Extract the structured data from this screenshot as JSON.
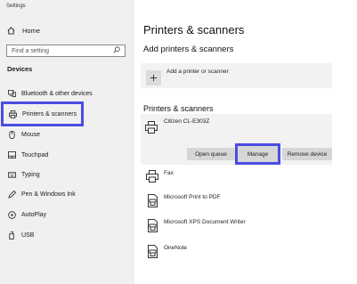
{
  "window": {
    "title": "Settings"
  },
  "sidebar": {
    "home": {
      "label": "Home",
      "icon": "home-icon"
    },
    "search": {
      "placeholder": "Find a setting",
      "icon": "search-icon"
    },
    "section_title": "Devices",
    "items": [
      {
        "label": "Bluetooth & other devices",
        "icon": "bluetooth-devices-icon"
      },
      {
        "label": "Printers & scanners",
        "icon": "printer-icon",
        "selected": true
      },
      {
        "label": "Mouse",
        "icon": "mouse-icon"
      },
      {
        "label": "Touchpad",
        "icon": "touchpad-icon"
      },
      {
        "label": "Typing",
        "icon": "keyboard-icon"
      },
      {
        "label": "Pen & Windows Ink",
        "icon": "pen-icon"
      },
      {
        "label": "AutoPlay",
        "icon": "autoplay-icon"
      },
      {
        "label": "USB",
        "icon": "usb-icon"
      }
    ]
  },
  "main": {
    "title": "Printers & scanners",
    "add_section": {
      "heading": "Add printers & scanners",
      "button_label": "Add a printer or scanner",
      "button_icon": "plus-icon"
    },
    "printers_section": {
      "heading": "Printers & scanners",
      "selected_printer": {
        "name": "Citizen CL-E303Z",
        "icon": "printer-icon",
        "buttons": {
          "open_queue": "Open queue",
          "manage": "Manage",
          "remove": "Remove device"
        }
      },
      "devices": [
        {
          "name": "Fax",
          "icon": "printer-icon"
        },
        {
          "name": "Microsoft Print to PDF",
          "icon": "pdf-printer-icon"
        },
        {
          "name": "Microsoft XPS Document Writer",
          "icon": "xps-printer-icon"
        },
        {
          "name": "OneNote",
          "icon": "onenote-printer-icon"
        }
      ]
    }
  },
  "colors": {
    "sidebar_bg": "#f0f0f0",
    "highlight_border": "#4a4de0",
    "card_bg": "#f2f2f2",
    "button_bg": "#d6d6d6"
  }
}
